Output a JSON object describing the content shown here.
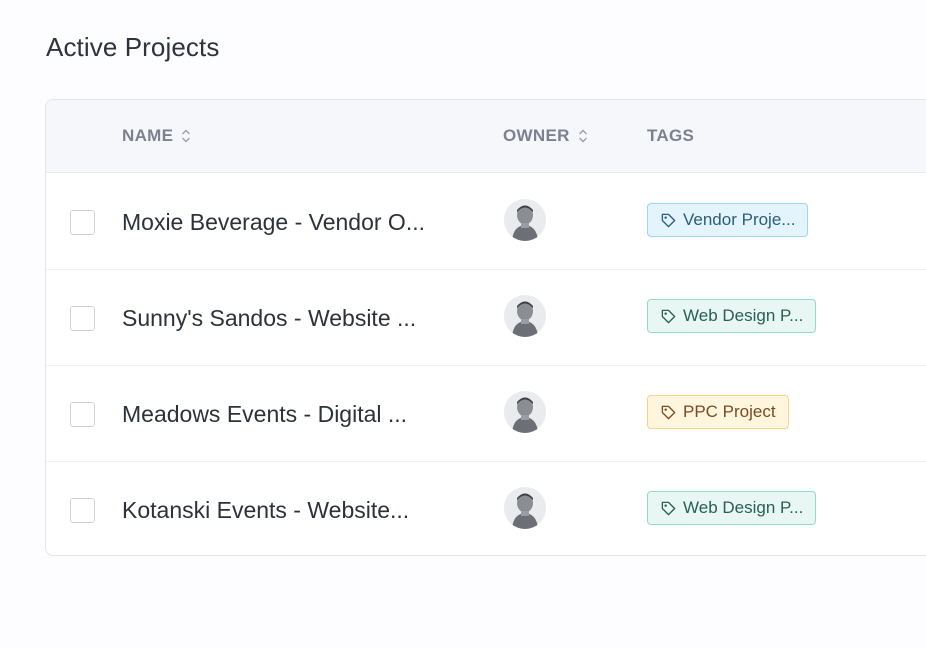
{
  "page": {
    "title": "Active Projects"
  },
  "table": {
    "columns": [
      {
        "label": "NAME",
        "sortable": true
      },
      {
        "label": "OWNER",
        "sortable": true
      },
      {
        "label": "TAGS",
        "sortable": false
      }
    ],
    "rows": [
      {
        "name": "Moxie Beverage - Vendor O...",
        "owner_avatar": "avatar-icon",
        "tag": "Vendor Proje...",
        "tag_color": "#e3f4fc"
      },
      {
        "name": "Sunny's Sandos - Website ...",
        "owner_avatar": "avatar-icon",
        "tag": "Web Design P...",
        "tag_color": "#e8f7f3"
      },
      {
        "name": "Meadows Events - Digital ...",
        "owner_avatar": "avatar-icon",
        "tag": "PPC Project",
        "tag_color": "#fff6dd"
      },
      {
        "name": "Kotanski Events - Website...",
        "owner_avatar": "avatar-icon",
        "tag": "Web Design P...",
        "tag_color": "#e8f7f3"
      }
    ]
  }
}
